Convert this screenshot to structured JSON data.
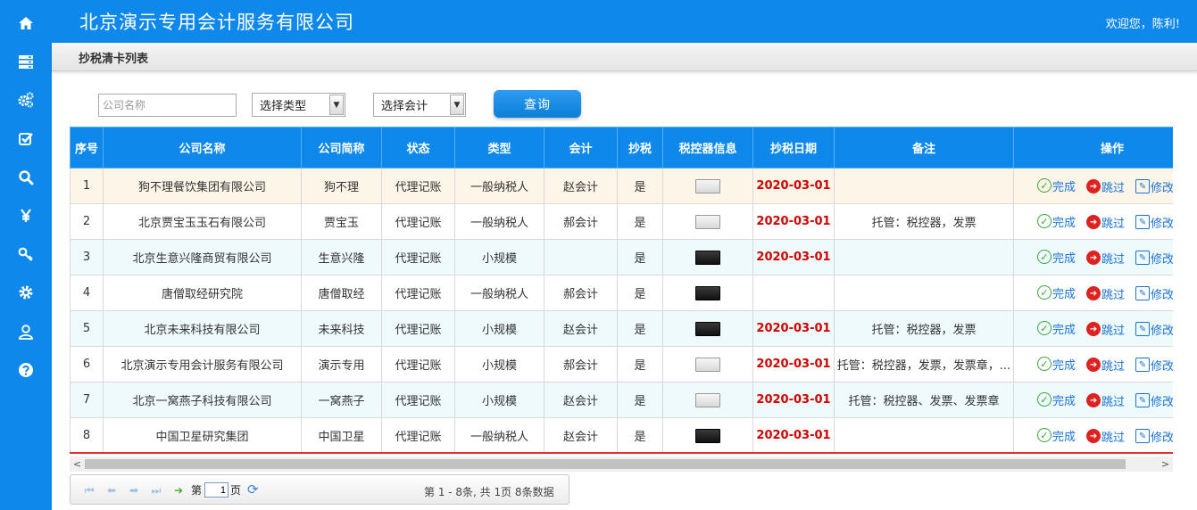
{
  "header": {
    "title": "北京演示专用会计服务有限公司",
    "welcome": "欢迎您，陈利!"
  },
  "sidebar": {
    "items": [
      {
        "icon": "home-icon"
      },
      {
        "icon": "server-icon"
      },
      {
        "icon": "gears-icon"
      },
      {
        "icon": "check-square-icon"
      },
      {
        "icon": "search-icon"
      },
      {
        "icon": "yen-icon"
      },
      {
        "icon": "key-icon"
      },
      {
        "icon": "gear-icon"
      },
      {
        "icon": "user-icon"
      },
      {
        "icon": "help-icon"
      }
    ]
  },
  "page": {
    "title": "抄税清卡列表"
  },
  "filters": {
    "company_placeholder": "公司名称",
    "type_select": "选择类型",
    "accountant_select": "选择会计",
    "query_button": "查询"
  },
  "table": {
    "columns": [
      "序号",
      "公司名称",
      "公司简称",
      "状态",
      "类型",
      "会计",
      "抄税",
      "税控器信息",
      "抄税日期",
      "备注",
      "操作"
    ],
    "rows": [
      {
        "no": "1",
        "name": "狗不理餐饮集团有限公司",
        "short": "狗不理",
        "status": "代理记账",
        "type": "一般纳税人",
        "accountant": "赵会计",
        "tax": "是",
        "device": "light",
        "date": "2020-03-01",
        "remark": ""
      },
      {
        "no": "2",
        "name": "北京贾宝玉玉石有限公司",
        "short": "贾宝玉",
        "status": "代理记账",
        "type": "一般纳税人",
        "accountant": "郝会计",
        "tax": "是",
        "device": "light",
        "date": "2020-03-01",
        "remark": "托管：税控器，发票"
      },
      {
        "no": "3",
        "name": "北京生意兴隆商贸有限公司",
        "short": "生意兴隆",
        "status": "代理记账",
        "type": "小规模",
        "accountant": "",
        "tax": "是",
        "device": "dark",
        "date": "2020-03-01",
        "remark": ""
      },
      {
        "no": "4",
        "name": "唐僧取经研究院",
        "short": "唐僧取经",
        "status": "代理记账",
        "type": "一般纳税人",
        "accountant": "郝会计",
        "tax": "是",
        "device": "dark",
        "date": "",
        "remark": ""
      },
      {
        "no": "5",
        "name": "北京未来科技有限公司",
        "short": "未来科技",
        "status": "代理记账",
        "type": "小规模",
        "accountant": "赵会计",
        "tax": "是",
        "device": "dark",
        "date": "2020-03-01",
        "remark": "托管：税控器，发票"
      },
      {
        "no": "6",
        "name": "北京演示专用会计服务有限公司",
        "short": "演示专用",
        "status": "代理记账",
        "type": "小规模",
        "accountant": "郝会计",
        "tax": "是",
        "device": "light",
        "date": "2020-03-01",
        "remark": "托管：税控器，发票，发票章，..."
      },
      {
        "no": "7",
        "name": "北京一窝燕子科技有限公司",
        "short": "一窝燕子",
        "status": "代理记账",
        "type": "小规模",
        "accountant": "赵会计",
        "tax": "是",
        "device": "light",
        "date": "2020-03-01",
        "remark": "托管：税控器、发票、发票章"
      },
      {
        "no": "8",
        "name": "中国卫星研究集团",
        "short": "中国卫星",
        "status": "代理记账",
        "type": "一般纳税人",
        "accountant": "赵会计",
        "tax": "是",
        "device": "dark",
        "date": "2020-03-01",
        "remark": ""
      }
    ],
    "actions": {
      "done": "完成",
      "skip": "跳过",
      "edit": "修改"
    }
  },
  "pager": {
    "page_prefix": "第",
    "page_value": "1",
    "page_suffix": "页",
    "info": "第 1 - 8条, 共 1页 8条数据"
  },
  "colors": {
    "primary": "#0f88eb",
    "date_red": "#d00000",
    "row_highlight": "#fdf5e7",
    "row_alt": "#eefafc"
  }
}
